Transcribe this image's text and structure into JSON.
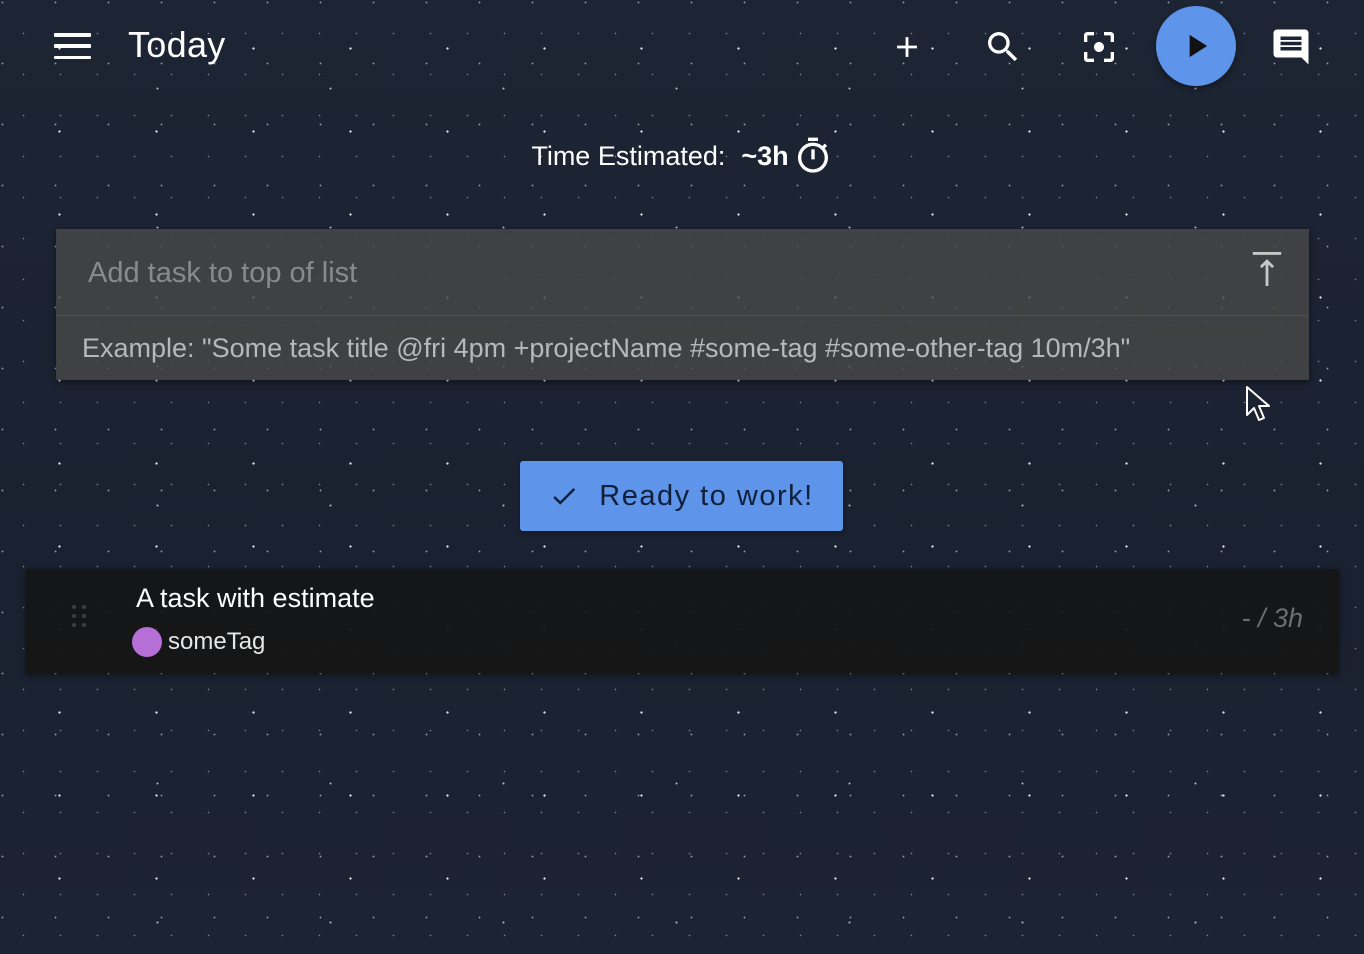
{
  "header": {
    "title": "Today",
    "icons": {
      "menu": "menu-icon",
      "add": "plus-icon",
      "search": "search-icon",
      "focus": "focus-mode-icon",
      "play": "play-icon",
      "notes": "notes-icon"
    }
  },
  "time_estimate": {
    "label": "Time Estimated:",
    "value": "~3h",
    "icon": "timer-icon"
  },
  "add_task": {
    "placeholder": "Add task to top of list",
    "value": "",
    "hint": "Example: \"Some task title @fri 4pm +projectName #some-tag #some-other-tag 10m/3h\"",
    "icon": "add-to-top-icon"
  },
  "ready_button": {
    "label": "Ready to work!",
    "icon": "check-icon"
  },
  "tasks": [
    {
      "title": "A task with estimate",
      "tag": {
        "label": "someTag",
        "color": "#b56fd6"
      },
      "time": "- / 3h"
    }
  ],
  "colors": {
    "accent": "#5e94ea",
    "background": "#1b2230",
    "task_background": "#161616"
  }
}
